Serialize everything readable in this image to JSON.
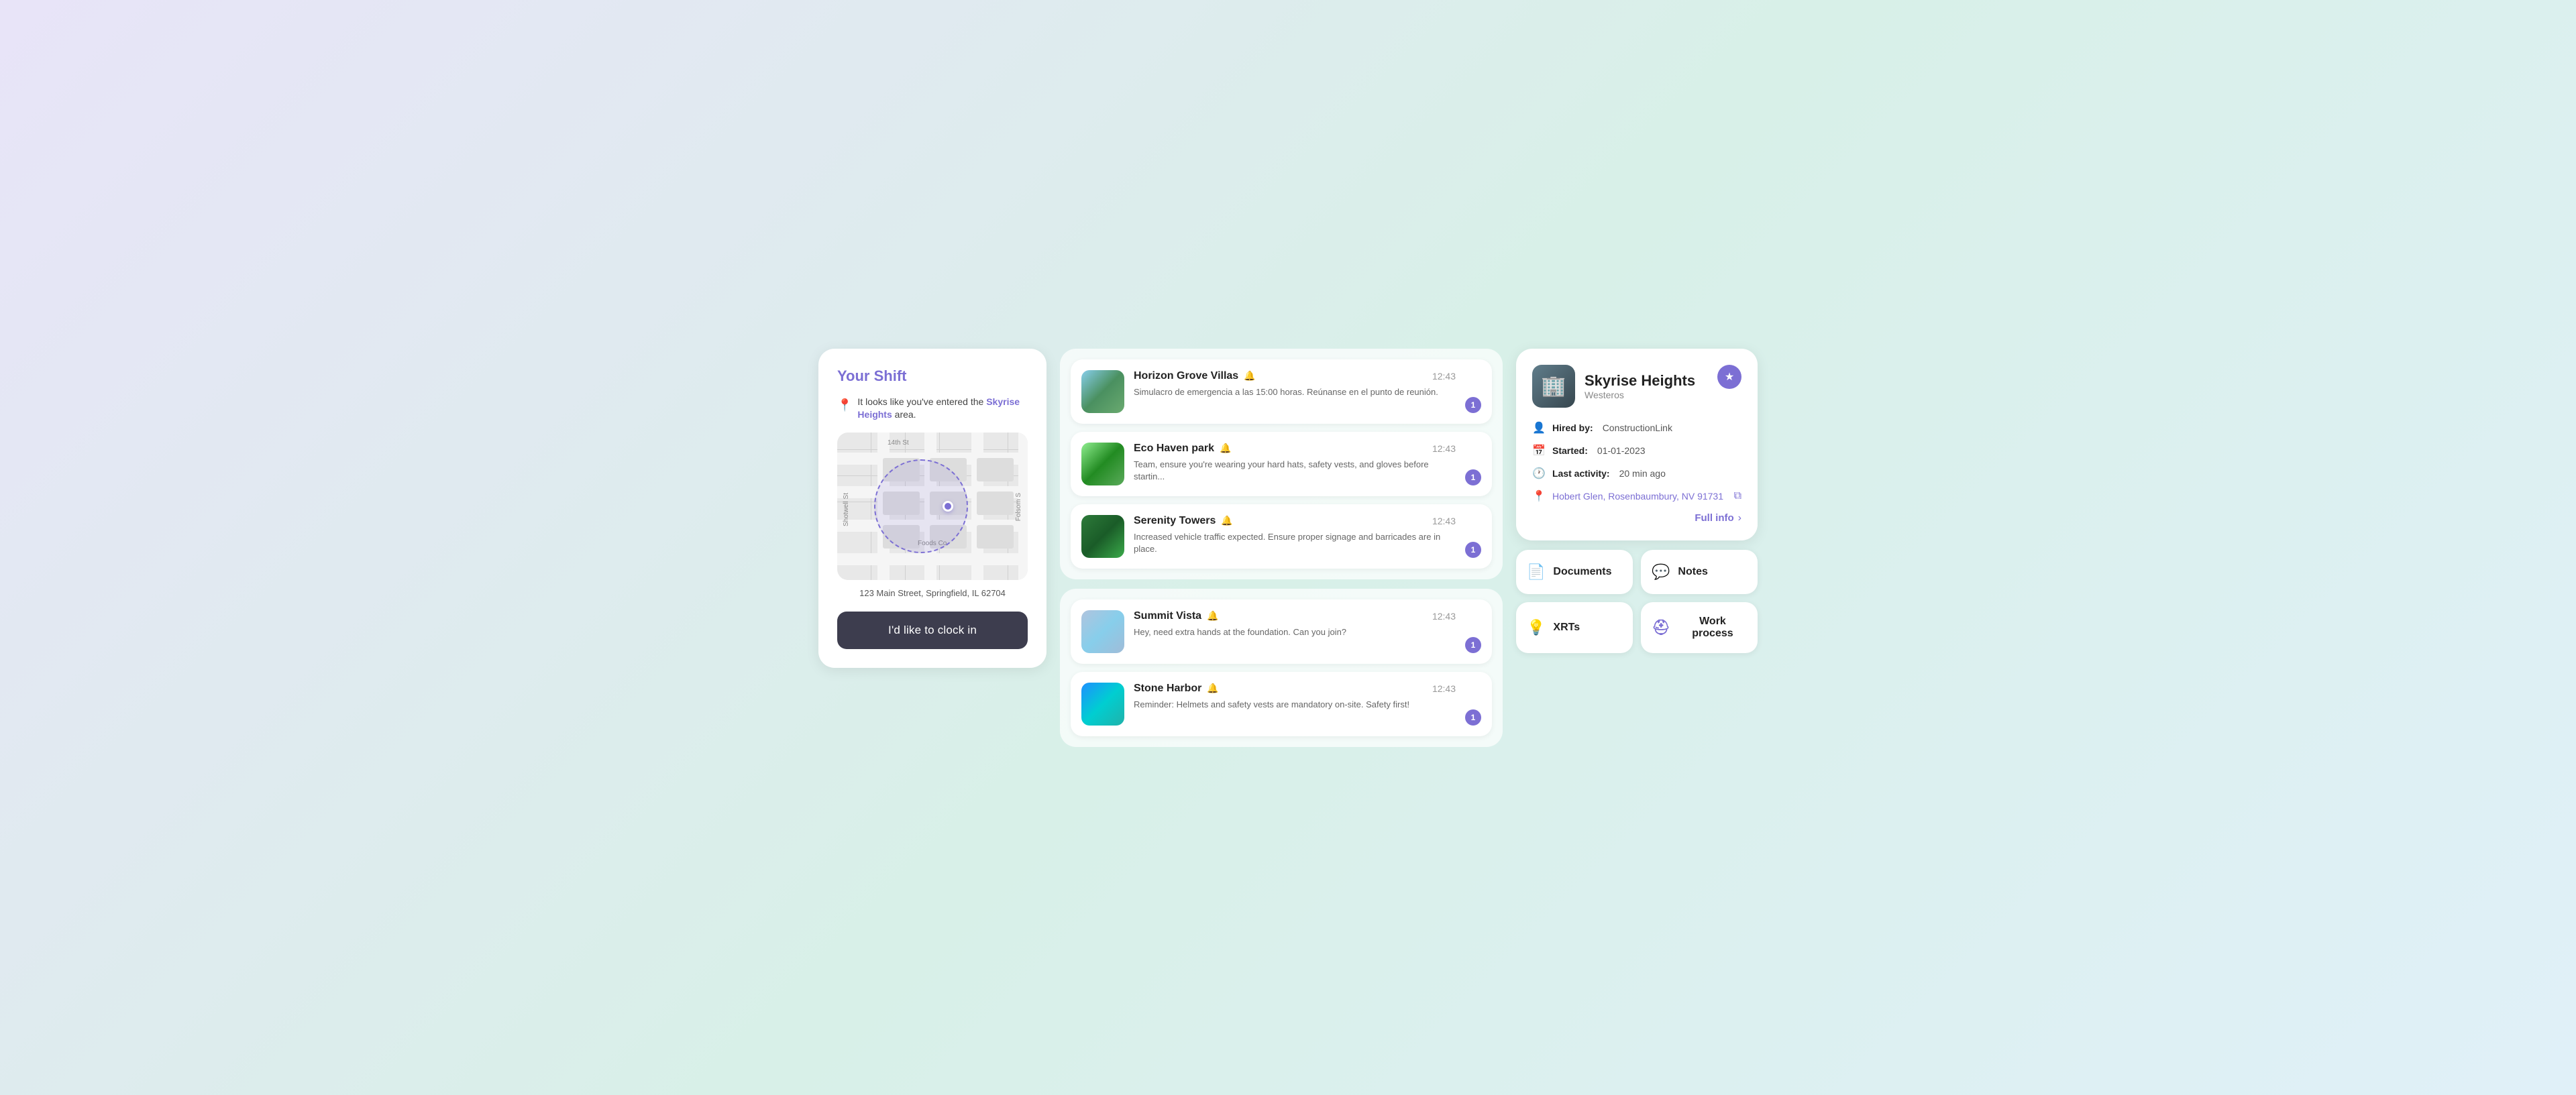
{
  "left": {
    "title": "Your Shift",
    "notice": "It looks like you've entered the",
    "notice_link": "Skyrise Heights",
    "notice_suffix": " area.",
    "address": "123 Main Street, Springfield, IL 62704",
    "clock_in_btn": "I'd like to clock in"
  },
  "middle": {
    "top_cards": [
      {
        "id": 1,
        "title": "Horizon Grove Villas",
        "time": "12:43",
        "text": "Simulacro de emergencia a las 15:00 horas. Reúnanse en el punto de reunión.",
        "badge": "1",
        "img_class": "img-horizon"
      },
      {
        "id": 2,
        "title": "Eco Haven park",
        "time": "12:43",
        "text": "Team, ensure you're wearing your hard hats, safety vests, and gloves before startin...",
        "badge": "1",
        "img_class": "img-eco"
      },
      {
        "id": 3,
        "title": "Serenity Towers",
        "time": "12:43",
        "text": "Increased vehicle traffic expected. Ensure proper signage and barricades are in place.",
        "badge": "1",
        "img_class": "img-serenity"
      }
    ],
    "bottom_cards": [
      {
        "id": 4,
        "title": "Summit Vista",
        "time": "12:43",
        "text": "Hey, need extra hands at the foundation. Can you join?",
        "badge": "1",
        "img_class": "img-summit"
      },
      {
        "id": 5,
        "title": "Stone Harbor",
        "time": "12:43",
        "text": "Reminder: Helmets and safety vests are mandatory on-site. Safety first!",
        "badge": "1",
        "img_class": "img-stone"
      }
    ]
  },
  "right": {
    "building_name": "Skyrise Heights",
    "building_location": "Westeros",
    "hired_by_label": "Hired by:",
    "hired_by_value": "ConstructionLink",
    "started_label": "Started:",
    "started_value": "01-01-2023",
    "last_activity_label": "Last activity:",
    "last_activity_value": "20 min ago",
    "address": "Hobert Glen, Rosenbaumbury, NV 91731",
    "full_info": "Full info",
    "actions": [
      {
        "id": "documents",
        "label": "Documents",
        "icon": "📄"
      },
      {
        "id": "notes",
        "label": "Notes",
        "icon": "💬"
      },
      {
        "id": "xrts",
        "label": "XRTs",
        "icon": "💡"
      },
      {
        "id": "work-process",
        "label": "Work process",
        "icon": "⛑"
      }
    ]
  }
}
